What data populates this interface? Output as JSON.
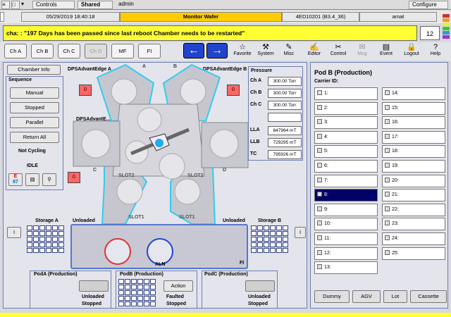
{
  "title_bar": {
    "controls": "Controls",
    "shared": "Shared",
    "user": "admin",
    "configure": "Configure"
  },
  "status": {
    "date": "05/29/2019 18:40:18",
    "screen": "Monitor Wafer",
    "tool_id": "4ED10201 (B3.4_36)",
    "site": "amat"
  },
  "alarm": {
    "text": "cha: : \"197 Days has been passed since last reboot Chamber needs to be restarted\"",
    "count": "12"
  },
  "chamber_tabs": [
    "Ch A",
    "Ch B",
    "Ch C",
    "Ch D",
    "MF",
    "FI"
  ],
  "tools": [
    {
      "label": "Favorite",
      "icon": "☆"
    },
    {
      "label": "System",
      "icon": "⚒"
    },
    {
      "label": "Misc",
      "icon": "✎"
    },
    {
      "label": "Editor",
      "icon": "✍"
    },
    {
      "label": "Control",
      "icon": "✂"
    },
    {
      "label": "Msg",
      "icon": "✉"
    },
    {
      "label": "Event",
      "icon": "▤"
    },
    {
      "label": "Logout",
      "icon": "🔒"
    },
    {
      "label": "Help",
      "icon": "?"
    }
  ],
  "left": {
    "chamber_info": "Chamber Info",
    "sequence": "Sequence",
    "manual": "Manual",
    "stopped": "Stopped",
    "parallel": "Parallel",
    "return_all": "Return All",
    "cycling": "Not Cycling",
    "state": "IDLE"
  },
  "chambers": {
    "a": "DPSAdvantEdge A",
    "b": "DPSAdvantEdge B",
    "c": "DPSAdvantE...",
    "a_short": "A",
    "b_short": "B",
    "c_short": "C",
    "d_short": "D",
    "red_label": "0"
  },
  "slots": {
    "slot1": "SLOT1",
    "slot2": "SLOT2"
  },
  "pressure": {
    "title": "Pressure",
    "rows": [
      {
        "label": "Ch A",
        "value": "300.00 Torr"
      },
      {
        "label": "Ch B",
        "value": "300.00 Torr"
      },
      {
        "label": "Ch C",
        "value": "300.00 Torr"
      },
      {
        "label": "",
        "value": ""
      },
      {
        "label": "LLA",
        "value": "847964 mT"
      },
      {
        "label": "LLB",
        "value": "729295 mT"
      },
      {
        "label": "TC",
        "value": "795926 mT"
      }
    ]
  },
  "storage": {
    "a": "Storage A",
    "b": "Storage B",
    "unloaded": "Unloaded",
    "aln": "ALN",
    "fi": "FI",
    "marker": "I"
  },
  "pods": [
    {
      "name": "PodA (Production)",
      "status1": "Unloaded",
      "status2": "Stopped",
      "action": ""
    },
    {
      "name": "PodB (Production)",
      "status1": "Faulted",
      "status2": "Stopped",
      "action": "Action"
    },
    {
      "name": "PodC (Production)",
      "status1": "Unloaded",
      "status2": "Stopped",
      "action": ""
    }
  ],
  "pod_b": {
    "title": "Pod B (Production)",
    "carrier_label": "Carrier ID:",
    "slots_left": [
      "1:",
      "2:",
      "3:",
      "4:",
      "5:",
      "6:",
      "7:",
      "8:",
      "9:",
      "10:",
      "11:",
      "12:",
      "13:"
    ],
    "slots_right": [
      "14:",
      "15:",
      "16:",
      "17:",
      "18:",
      "19:",
      "20:",
      "21:",
      "22:",
      "23:",
      "24:",
      "25:"
    ],
    "selected": "8:"
  },
  "bottom_buttons": [
    "Dummy",
    "AGV",
    "Lot",
    "Cassette"
  ],
  "colors": {
    "accent": "#2244cc",
    "alarm": "#ffff33",
    "chamber_outline": "#33ccee",
    "selected": "#000066"
  }
}
